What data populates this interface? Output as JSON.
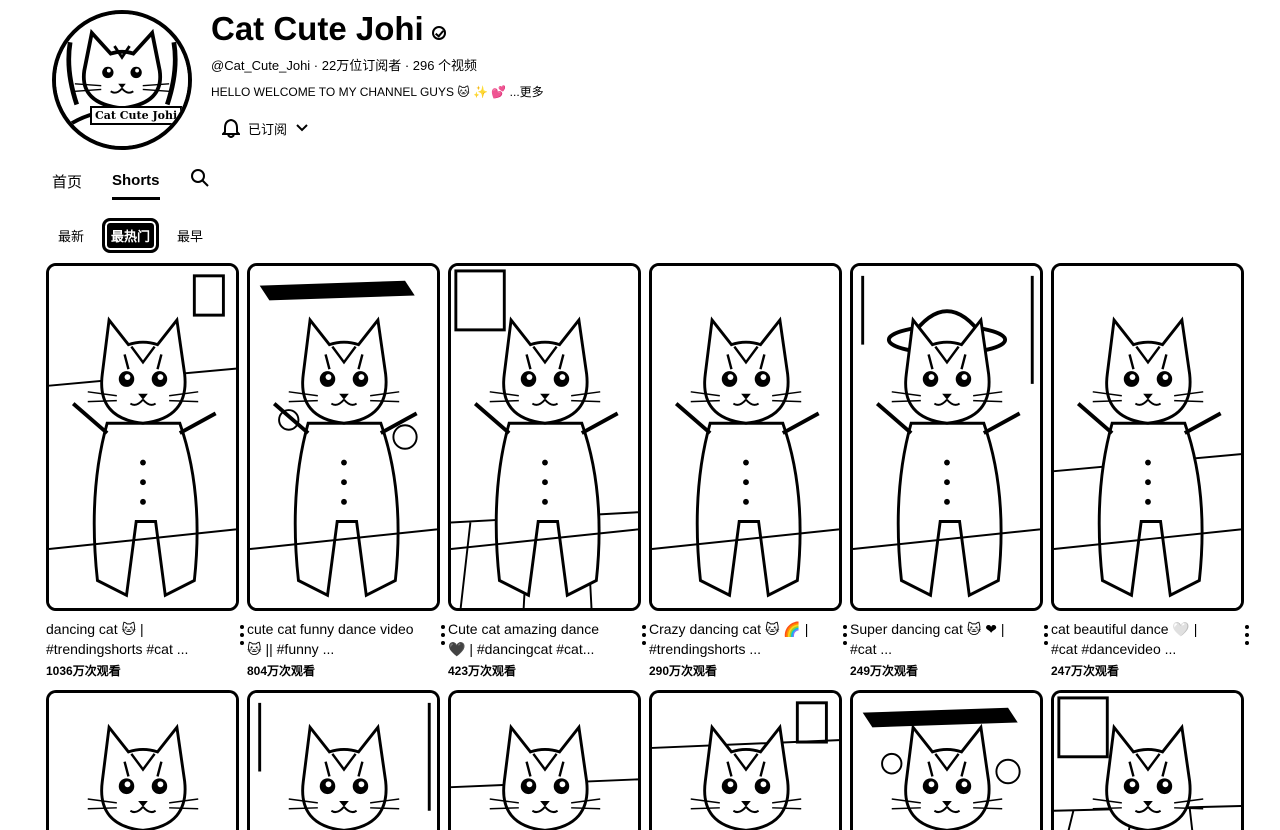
{
  "channel": {
    "avatar_tag": "Cat Cute Johi",
    "name": "Cat Cute Johi",
    "meta": "@Cat_Cute_Johi · 22万位订阅者 · 296 个视频",
    "description": "HELLO WELCOME TO MY CHANNEL GUYS 🐱 ✨ 💕 ...更多",
    "subscribe_label": "已订阅"
  },
  "tabs": [
    {
      "label": "首页",
      "active": false
    },
    {
      "label": "Shorts",
      "active": true
    }
  ],
  "sort_chips": [
    {
      "label": "最新",
      "active": false
    },
    {
      "label": "最热门",
      "active": true
    },
    {
      "label": "最早",
      "active": false
    }
  ],
  "shorts": [
    {
      "title": "dancing cat 🐱 | #trendingshorts #cat ...",
      "views": "1036万次观看"
    },
    {
      "title": "cute cat funny dance video 🐱 || #funny ...",
      "views": "804万次观看"
    },
    {
      "title": "Cute cat amazing dance 🖤 | #dancingcat #cat...",
      "views": "423万次观看"
    },
    {
      "title": "Crazy dancing cat 🐱 🌈 | #trendingshorts ...",
      "views": "290万次观看"
    },
    {
      "title": "Super dancing cat 🐱 ❤ | #cat ...",
      "views": "249万次观看"
    },
    {
      "title": "cat beautiful dance 🤍 | #cat #dancevideo ...",
      "views": "247万次观看"
    }
  ]
}
